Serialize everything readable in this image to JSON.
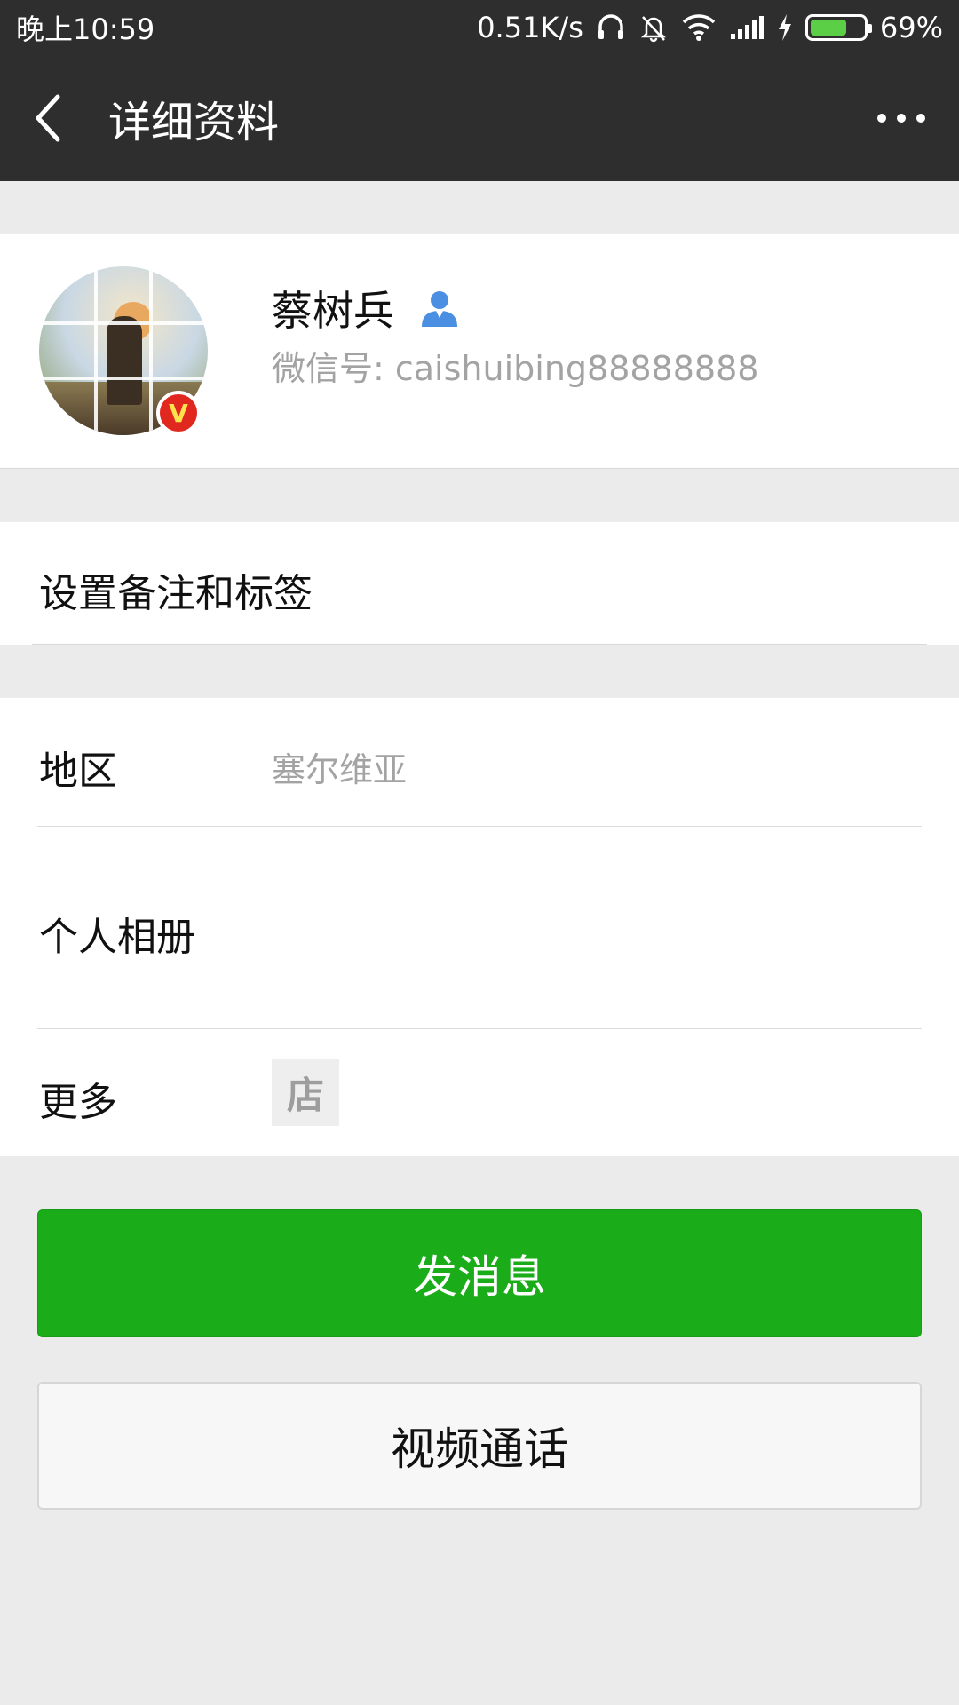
{
  "status_bar": {
    "time": "晚上10:59",
    "net_speed": "0.51K/s",
    "battery": "69%",
    "battery_level": 0.69,
    "icons": [
      "headphones-icon",
      "mute-bell-icon",
      "wifi-icon",
      "signal-icon",
      "charging-icon",
      "battery-icon"
    ]
  },
  "header": {
    "title": "详细资料",
    "back_icon": "chevron-left-icon",
    "more_icon": "more-dots-icon"
  },
  "profile": {
    "name": "蔡树兵",
    "wechat_id": "微信号: caishuibing88888888",
    "verified_badge": "V",
    "gender_icon": "person-icon",
    "gender_icon_color": "#4a8fe2"
  },
  "remark": {
    "label": "设置备注和标签"
  },
  "info": {
    "region_label": "地区",
    "region_value": "塞尔维亚",
    "album_label": "个人相册",
    "more_label": "更多",
    "shop_glyph": "店"
  },
  "actions": {
    "send_message": "发消息",
    "video_call": "视频通话"
  },
  "colors": {
    "header_bg": "#2e2e2e",
    "page_bg": "#ebebeb",
    "primary_green": "#1aad19",
    "secondary_text": "#a3a3a3"
  }
}
